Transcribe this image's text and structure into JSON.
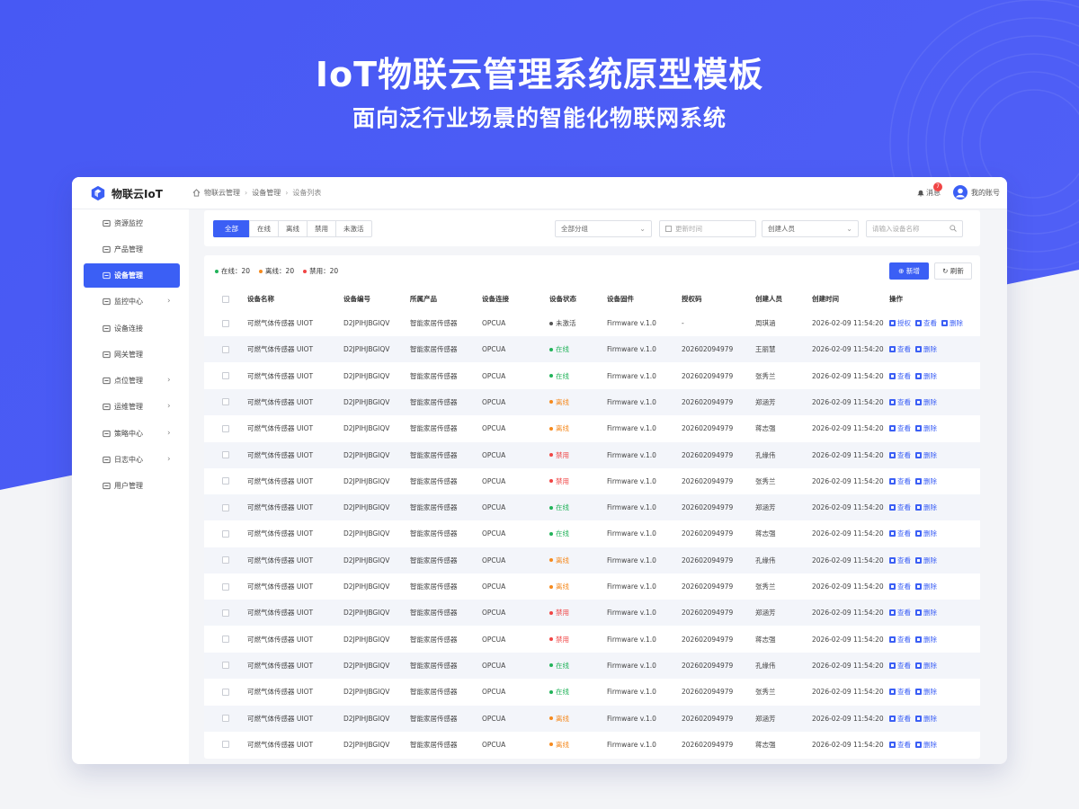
{
  "hero": {
    "title": "IoT物联云管理系统原型模板",
    "subtitle": "面向泛行业场景的智能化物联网系统"
  },
  "colors": {
    "hero_blue": "#4a5cf5",
    "accent": "#3b5ff5",
    "online": "#22b35a",
    "offline": "#f58a1f",
    "disabled": "#f04545",
    "inactive": "#555555"
  },
  "app": {
    "logo_text": "物联云IoT",
    "breadcrumb": [
      "物联云管理",
      "设备管理",
      "设备列表"
    ],
    "messages_label": "消息",
    "messages_count": "7",
    "account_label": "我的账号"
  },
  "sidebar": {
    "items": [
      {
        "label": "资源监控",
        "icon": "monitor-icon",
        "has_arrow": false,
        "active": false
      },
      {
        "label": "产品管理",
        "icon": "product-icon",
        "has_arrow": false,
        "active": false
      },
      {
        "label": "设备管理",
        "icon": "device-icon",
        "has_arrow": false,
        "active": true
      },
      {
        "label": "监控中心",
        "icon": "camera-icon",
        "has_arrow": true,
        "active": false
      },
      {
        "label": "设备连接",
        "icon": "link-icon",
        "has_arrow": false,
        "active": false
      },
      {
        "label": "网关管理",
        "icon": "cloud-icon",
        "has_arrow": false,
        "active": false
      },
      {
        "label": "点位管理",
        "icon": "point-icon",
        "has_arrow": true,
        "active": false
      },
      {
        "label": "运维管理",
        "icon": "ops-icon",
        "has_arrow": true,
        "active": false
      },
      {
        "label": "策略中心",
        "icon": "shield-icon",
        "has_arrow": true,
        "active": false
      },
      {
        "label": "日志中心",
        "icon": "log-icon",
        "has_arrow": true,
        "active": false
      },
      {
        "label": "用户管理",
        "icon": "user-icon",
        "has_arrow": false,
        "active": false
      }
    ]
  },
  "filters": {
    "tabs": [
      "全部",
      "在线",
      "离线",
      "禁用",
      "未激活"
    ],
    "active_tab": 0,
    "group_select": "全部分组",
    "time_placeholder": "更新时间",
    "creator_select": "创建人员",
    "search_placeholder": "请输入设备名称"
  },
  "stats": [
    {
      "label": "在线：",
      "value": "20",
      "color": "#22b35a"
    },
    {
      "label": "离线：",
      "value": "20",
      "color": "#f58a1f"
    },
    {
      "label": "禁用：",
      "value": "20",
      "color": "#f04545"
    }
  ],
  "actions": {
    "add_label": "新增",
    "refresh_label": "刷新"
  },
  "table": {
    "columns": [
      "设备名称",
      "设备编号",
      "所属产品",
      "设备连接",
      "设备状态",
      "设备固件",
      "授权码",
      "创建人员",
      "创建时间",
      "操作"
    ],
    "rows": [
      {
        "name": "可燃气体传感器 UIOT",
        "code": "D2JPIHJBGIQV",
        "product": "智能家居传感器",
        "conn": "OPCUA",
        "status": "未激活",
        "status_color": "#555555",
        "firmware": "Firmware v.1.0",
        "auth": "-",
        "creator": "周琪涵",
        "time": "2026-02-09 11:54:20",
        "ops": [
          "授权",
          "查看",
          "删除"
        ]
      },
      {
        "name": "可燃气体传感器 UIOT",
        "code": "D2JPIHJBGIQV",
        "product": "智能家居传感器",
        "conn": "OPCUA",
        "status": "在线",
        "status_color": "#22b35a",
        "firmware": "Firmware v.1.0",
        "auth": "202602094979",
        "creator": "王丽慧",
        "time": "2026-02-09 11:54:20",
        "ops": [
          "查看",
          "删除"
        ]
      },
      {
        "name": "可燃气体传感器 UIOT",
        "code": "D2JPIHJBGIQV",
        "product": "智能家居传感器",
        "conn": "OPCUA",
        "status": "在线",
        "status_color": "#22b35a",
        "firmware": "Firmware v.1.0",
        "auth": "202602094979",
        "creator": "张秀兰",
        "time": "2026-02-09 11:54:20",
        "ops": [
          "查看",
          "删除"
        ]
      },
      {
        "name": "可燃气体传感器 UIOT",
        "code": "D2JPIHJBGIQV",
        "product": "智能家居传感器",
        "conn": "OPCUA",
        "status": "离线",
        "status_color": "#f58a1f",
        "firmware": "Firmware v.1.0",
        "auth": "202602094979",
        "creator": "郑涵芳",
        "time": "2026-02-09 11:54:20",
        "ops": [
          "查看",
          "删除"
        ]
      },
      {
        "name": "可燃气体传感器 UIOT",
        "code": "D2JPIHJBGIQV",
        "product": "智能家居传感器",
        "conn": "OPCUA",
        "status": "离线",
        "status_color": "#f58a1f",
        "firmware": "Firmware v.1.0",
        "auth": "202602094979",
        "creator": "蒋志强",
        "time": "2026-02-09 11:54:20",
        "ops": [
          "查看",
          "删除"
        ]
      },
      {
        "name": "可燃气体传感器 UIOT",
        "code": "D2JPIHJBGIQV",
        "product": "智能家居传感器",
        "conn": "OPCUA",
        "status": "禁用",
        "status_color": "#f04545",
        "firmware": "Firmware v.1.0",
        "auth": "202602094979",
        "creator": "孔缘伟",
        "time": "2026-02-09 11:54:20",
        "ops": [
          "查看",
          "删除"
        ]
      },
      {
        "name": "可燃气体传感器 UIOT",
        "code": "D2JPIHJBGIQV",
        "product": "智能家居传感器",
        "conn": "OPCUA",
        "status": "禁用",
        "status_color": "#f04545",
        "firmware": "Firmware v.1.0",
        "auth": "202602094979",
        "creator": "张秀兰",
        "time": "2026-02-09 11:54:20",
        "ops": [
          "查看",
          "删除"
        ]
      },
      {
        "name": "可燃气体传感器 UIOT",
        "code": "D2JPIHJBGIQV",
        "product": "智能家居传感器",
        "conn": "OPCUA",
        "status": "在线",
        "status_color": "#22b35a",
        "firmware": "Firmware v.1.0",
        "auth": "202602094979",
        "creator": "郑涵芳",
        "time": "2026-02-09 11:54:20",
        "ops": [
          "查看",
          "删除"
        ]
      },
      {
        "name": "可燃气体传感器 UIOT",
        "code": "D2JPIHJBGIQV",
        "product": "智能家居传感器",
        "conn": "OPCUA",
        "status": "在线",
        "status_color": "#22b35a",
        "firmware": "Firmware v.1.0",
        "auth": "202602094979",
        "creator": "蒋志强",
        "time": "2026-02-09 11:54:20",
        "ops": [
          "查看",
          "删除"
        ]
      },
      {
        "name": "可燃气体传感器 UIOT",
        "code": "D2JPIHJBGIQV",
        "product": "智能家居传感器",
        "conn": "OPCUA",
        "status": "离线",
        "status_color": "#f58a1f",
        "firmware": "Firmware v.1.0",
        "auth": "202602094979",
        "creator": "孔缘伟",
        "time": "2026-02-09 11:54:20",
        "ops": [
          "查看",
          "删除"
        ]
      },
      {
        "name": "可燃气体传感器 UIOT",
        "code": "D2JPIHJBGIQV",
        "product": "智能家居传感器",
        "conn": "OPCUA",
        "status": "离线",
        "status_color": "#f58a1f",
        "firmware": "Firmware v.1.0",
        "auth": "202602094979",
        "creator": "张秀兰",
        "time": "2026-02-09 11:54:20",
        "ops": [
          "查看",
          "删除"
        ]
      },
      {
        "name": "可燃气体传感器 UIOT",
        "code": "D2JPIHJBGIQV",
        "product": "智能家居传感器",
        "conn": "OPCUA",
        "status": "禁用",
        "status_color": "#f04545",
        "firmware": "Firmware v.1.0",
        "auth": "202602094979",
        "creator": "郑涵芳",
        "time": "2026-02-09 11:54:20",
        "ops": [
          "查看",
          "删除"
        ]
      },
      {
        "name": "可燃气体传感器 UIOT",
        "code": "D2JPIHJBGIQV",
        "product": "智能家居传感器",
        "conn": "OPCUA",
        "status": "禁用",
        "status_color": "#f04545",
        "firmware": "Firmware v.1.0",
        "auth": "202602094979",
        "creator": "蒋志强",
        "time": "2026-02-09 11:54:20",
        "ops": [
          "查看",
          "删除"
        ]
      },
      {
        "name": "可燃气体传感器 UIOT",
        "code": "D2JPIHJBGIQV",
        "product": "智能家居传感器",
        "conn": "OPCUA",
        "status": "在线",
        "status_color": "#22b35a",
        "firmware": "Firmware v.1.0",
        "auth": "202602094979",
        "creator": "孔缘伟",
        "time": "2026-02-09 11:54:20",
        "ops": [
          "查看",
          "删除"
        ]
      },
      {
        "name": "可燃气体传感器 UIOT",
        "code": "D2JPIHJBGIQV",
        "product": "智能家居传感器",
        "conn": "OPCUA",
        "status": "在线",
        "status_color": "#22b35a",
        "firmware": "Firmware v.1.0",
        "auth": "202602094979",
        "creator": "张秀兰",
        "time": "2026-02-09 11:54:20",
        "ops": [
          "查看",
          "删除"
        ]
      },
      {
        "name": "可燃气体传感器 UIOT",
        "code": "D2JPIHJBGIQV",
        "product": "智能家居传感器",
        "conn": "OPCUA",
        "status": "离线",
        "status_color": "#f58a1f",
        "firmware": "Firmware v.1.0",
        "auth": "202602094979",
        "creator": "郑涵芳",
        "time": "2026-02-09 11:54:20",
        "ops": [
          "查看",
          "删除"
        ]
      },
      {
        "name": "可燃气体传感器 UIOT",
        "code": "D2JPIHJBGIQV",
        "product": "智能家居传感器",
        "conn": "OPCUA",
        "status": "离线",
        "status_color": "#f58a1f",
        "firmware": "Firmware v.1.0",
        "auth": "202602094979",
        "creator": "蒋志强",
        "time": "2026-02-09 11:54:20",
        "ops": [
          "查看",
          "删除"
        ]
      }
    ]
  }
}
